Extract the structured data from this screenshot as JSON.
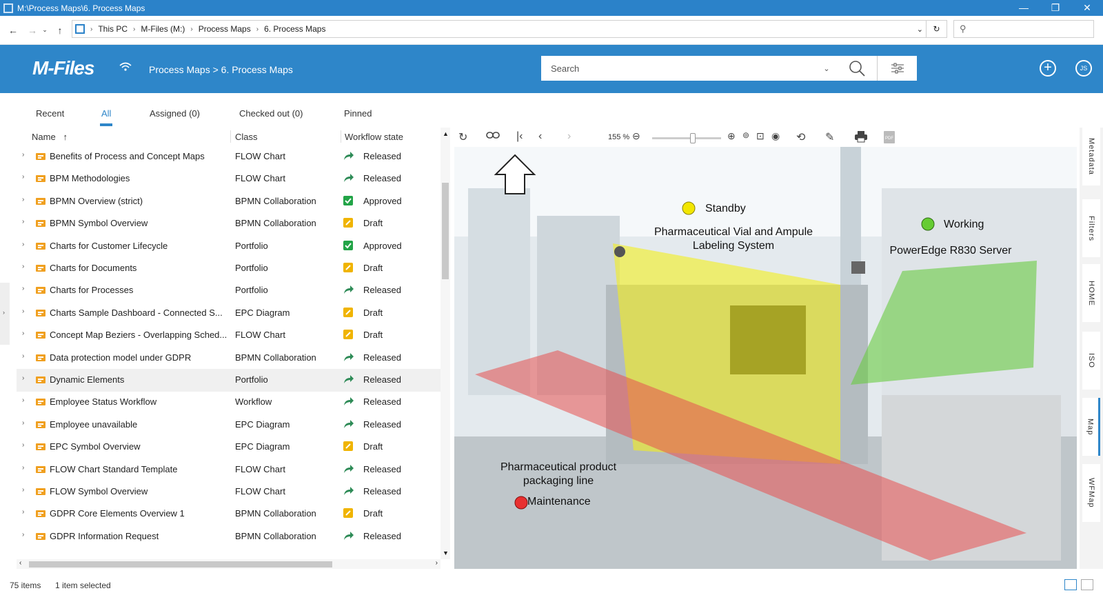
{
  "window": {
    "title": "M:\\Process Maps\\6. Process Maps",
    "minimize": "—",
    "maximize": "❐",
    "close": "✕"
  },
  "explorer": {
    "path": [
      "This PC",
      "M-Files (M:)",
      "Process Maps",
      "6. Process Maps"
    ],
    "search_placeholder": ""
  },
  "header": {
    "logo": "M-Files",
    "breadcrumb": "Process Maps > 6. Process Maps",
    "search_placeholder": "Search",
    "avatar": "JS"
  },
  "tabs": [
    {
      "label": "Recent"
    },
    {
      "label": "All"
    },
    {
      "label": "Assigned (0)"
    },
    {
      "label": "Checked out (0)"
    },
    {
      "label": "Pinned"
    }
  ],
  "columns": {
    "name": "Name",
    "sort_arrow": "↑",
    "class": "Class",
    "state": "Workflow state"
  },
  "items": [
    {
      "name": "Benefits of Process and Concept Maps",
      "class": "FLOW Chart",
      "state": "Released",
      "state_type": "released"
    },
    {
      "name": "BPM Methodologies",
      "class": "FLOW Chart",
      "state": "Released",
      "state_type": "released"
    },
    {
      "name": "BPMN Overview (strict)",
      "class": "BPMN Collaboration",
      "state": "Approved",
      "state_type": "approved"
    },
    {
      "name": "BPMN Symbol Overview",
      "class": "BPMN Collaboration",
      "state": "Draft",
      "state_type": "draft"
    },
    {
      "name": "Charts for Customer Lifecycle",
      "class": "Portfolio",
      "state": "Approved",
      "state_type": "approved"
    },
    {
      "name": "Charts for Documents",
      "class": "Portfolio",
      "state": "Draft",
      "state_type": "draft"
    },
    {
      "name": "Charts for Processes",
      "class": "Portfolio",
      "state": "Released",
      "state_type": "released"
    },
    {
      "name": "Charts Sample Dashboard - Connected S...",
      "class": "EPC Diagram",
      "state": "Draft",
      "state_type": "draft"
    },
    {
      "name": "Concept Map Beziers - Overlapping Sched...",
      "class": "FLOW Chart",
      "state": "Draft",
      "state_type": "draft"
    },
    {
      "name": "Data protection model under GDPR",
      "class": "BPMN Collaboration",
      "state": "Released",
      "state_type": "released"
    },
    {
      "name": "Dynamic Elements",
      "class": "Portfolio",
      "state": "Released",
      "state_type": "released",
      "selected": true
    },
    {
      "name": "Employee Status Workflow",
      "class": "Workflow",
      "state": "Released",
      "state_type": "released"
    },
    {
      "name": "Employee unavailable",
      "class": "EPC Diagram",
      "state": "Released",
      "state_type": "released"
    },
    {
      "name": "EPC Symbol Overview",
      "class": "EPC Diagram",
      "state": "Draft",
      "state_type": "draft"
    },
    {
      "name": "FLOW Chart Standard Template",
      "class": "FLOW Chart",
      "state": "Released",
      "state_type": "released"
    },
    {
      "name": "FLOW Symbol Overview",
      "class": "FLOW Chart",
      "state": "Released",
      "state_type": "released"
    },
    {
      "name": "GDPR Core Elements Overview 1",
      "class": "BPMN Collaboration",
      "state": "Draft",
      "state_type": "draft"
    },
    {
      "name": "GDPR Information Request",
      "class": "BPMN Collaboration",
      "state": "Released",
      "state_type": "released"
    }
  ],
  "viewer": {
    "zoom": "155 %",
    "zoom_fraction": 0.6,
    "labels": {
      "standby": "Standby",
      "vial": "Pharmaceutical Vial and Ampule\nLabeling System",
      "working": "Working",
      "server": "PowerEdge R830 Server",
      "packaging": "Pharmaceutical product\npackaging line",
      "maintenance": "Maintenance"
    },
    "colors": {
      "standby": "#f2e600",
      "working": "#66cc33",
      "maintenance": "#e83030"
    }
  },
  "side_tabs": [
    "Metadata",
    "Filters",
    "HOME",
    "ISO",
    "Map",
    "WFMap"
  ],
  "status": {
    "count": "75 items",
    "selection": "1 item selected"
  },
  "colors": {
    "accent": "#2e86c9",
    "released": "#2e8b57",
    "approved": "#22a447",
    "draft": "#f0b400",
    "file_icon": "#f0a020"
  }
}
